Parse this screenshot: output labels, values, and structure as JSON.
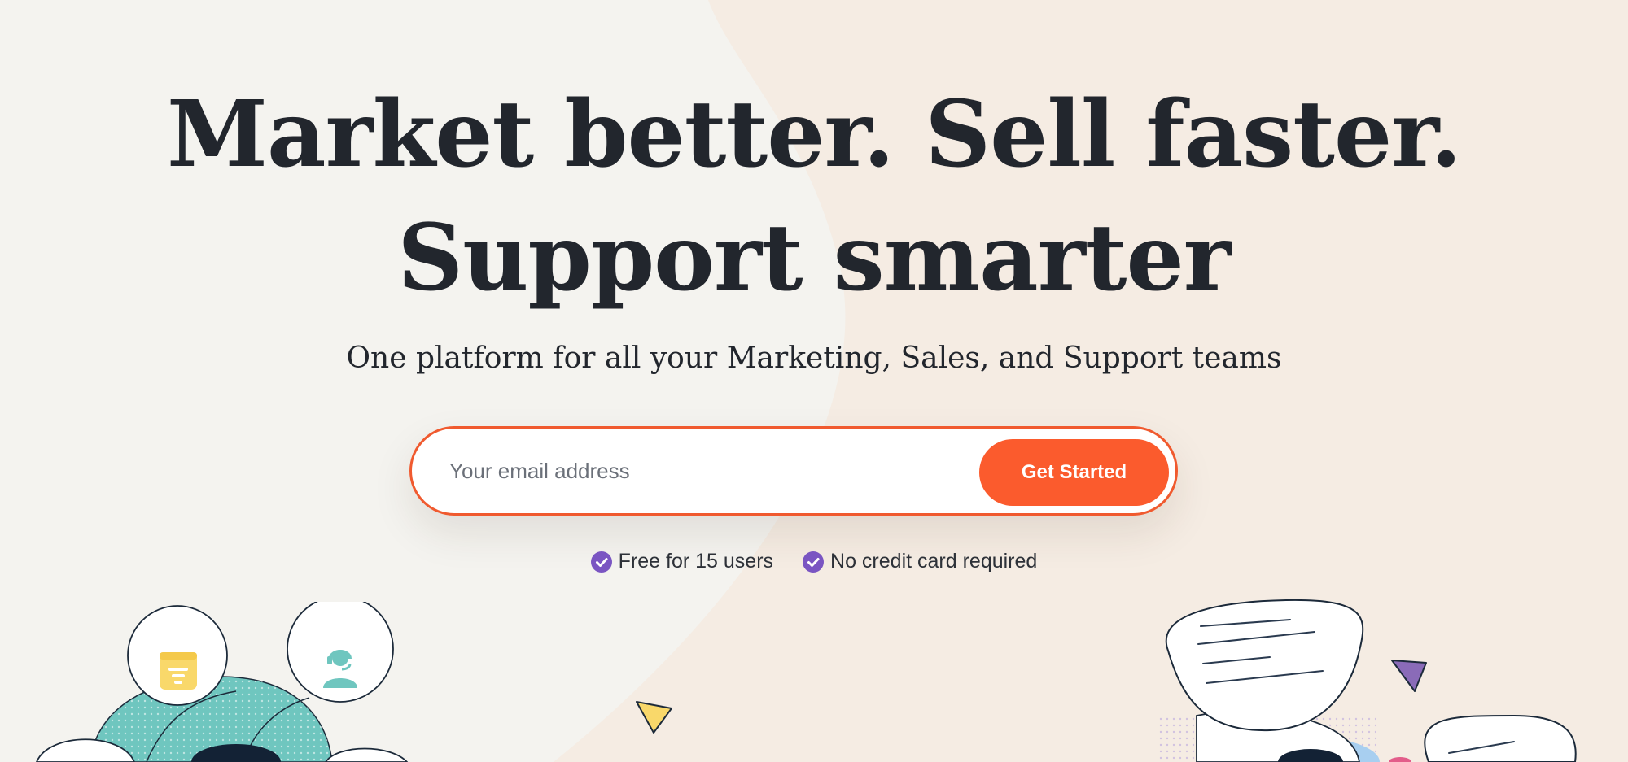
{
  "hero": {
    "headline_line1": "Market better. Sell faster.",
    "headline_line2": "Support smarter",
    "subheadline": "One platform for all your Marketing, Sales, and Support teams"
  },
  "signup": {
    "email_placeholder": "Your email address",
    "cta_label": "Get Started"
  },
  "perks": [
    {
      "icon": "check-circle-icon",
      "label": "Free for 15 users"
    },
    {
      "icon": "check-circle-icon",
      "label": "No credit card required"
    }
  ],
  "illustration_icons": [
    "calendar-icon",
    "headset-agent-icon",
    "chat-bubble-icon"
  ],
  "colors": {
    "accent": "#fb5b2d",
    "check": "#7a55c2",
    "text": "#22262d",
    "teal": "#6fc6bf",
    "yellow": "#f9d86a",
    "purple": "#8a6bb8"
  }
}
